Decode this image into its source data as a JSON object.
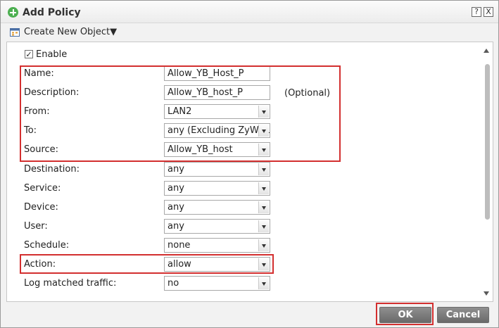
{
  "dialog": {
    "title": "Add Policy",
    "help_button": "?",
    "close_button": "X"
  },
  "toolbar": {
    "create_new_object": "Create New Object▼"
  },
  "form": {
    "enable_label": "Enable",
    "enable_checked": true,
    "enable_check": "✓",
    "name_label": "Name:",
    "name_value": "Allow_YB_Host_P",
    "description_label": "Description:",
    "description_value": "Allow_YB_host_P",
    "description_hint": "(Optional)",
    "from_label": "From:",
    "from_value": "LAN2",
    "to_label": "To:",
    "to_value": "any (Excluding ZyWALL)",
    "source_label": "Source:",
    "source_value": "Allow_YB_host",
    "destination_label": "Destination:",
    "destination_value": "any",
    "service_label": "Service:",
    "service_value": "any",
    "device_label": "Device:",
    "device_value": "any",
    "user_label": "User:",
    "user_value": "any",
    "schedule_label": "Schedule:",
    "schedule_value": "none",
    "action_label": "Action:",
    "action_value": "allow",
    "log_label": "Log matched traffic:",
    "log_value": "no"
  },
  "buttons": {
    "ok": "OK",
    "cancel": "Cancel"
  },
  "colors": {
    "highlight_box": "#d32f2f",
    "button_bg": "#7a7a7a",
    "add_icon": "#4caf50"
  }
}
